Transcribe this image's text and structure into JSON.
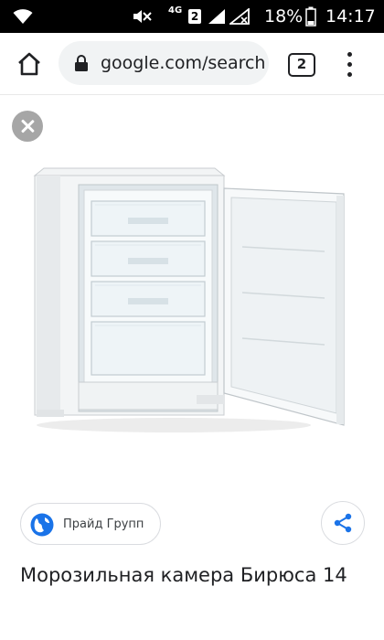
{
  "status_bar": {
    "network_label": "4G",
    "sim_number": "2",
    "battery_percent": "18%",
    "time": "14:17",
    "icons": [
      "wifi-icon",
      "mute-icon",
      "signal-icon",
      "no-sim-signal-icon",
      "battery-icon"
    ]
  },
  "browser": {
    "url": "google.com/search",
    "tab_count": "2",
    "icons": [
      "home-icon",
      "lock-icon",
      "menu-icon"
    ]
  },
  "image_viewer": {
    "close_icon": "close-icon",
    "image_subject": "white freezer with open door and four drawers"
  },
  "result": {
    "source_name": "Прайд Групп",
    "source_icon": "globe-icon",
    "share_icon": "share-icon",
    "title": "Морозильная камера Бирюса 14"
  },
  "colors": {
    "link_blue": "#1a73e8",
    "chip_border": "#dadce0",
    "close_gray": "#a6a6a6"
  }
}
